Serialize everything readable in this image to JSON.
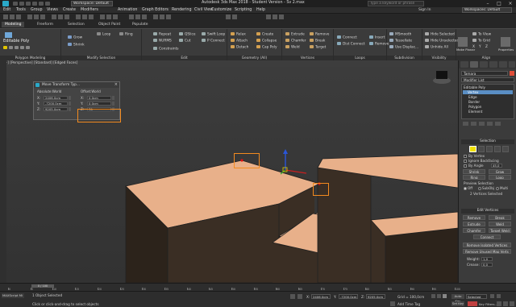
{
  "titlebar": {
    "workspace": "Workspace: Default",
    "title": "Autodesk 3ds Max 2018 - Student Version  - Sv 2.max",
    "search_placeholder": "Type a keyword or phrase"
  },
  "menubar": {
    "items": [
      "Edit",
      "Tools",
      "Group",
      "Views",
      "Create",
      "Modifiers",
      "Animation",
      "Graph Editors",
      "Rendering",
      "Civil View",
      "Customize",
      "Scripting",
      "Help"
    ],
    "sign_in": "Sign In",
    "workspaces": "Workspaces: Default"
  },
  "ribbon_tabs": [
    "Modeling",
    "Freeform",
    "Selection",
    "Object Paint",
    "Populate"
  ],
  "ribbon": {
    "polygon_modeling": {
      "object": "Editable Poly",
      "label": "Polygon Modeling"
    },
    "modify_selection": {
      "buttons": [
        "Grow",
        "Shrink",
        "Loop",
        "Ring"
      ],
      "label": "Modify Selection"
    },
    "edit": {
      "buttons": [
        "Repeat",
        "QSlice",
        "Swift Loop",
        "NURMS",
        "Cut",
        "P Connect",
        "Constraints"
      ],
      "label": "Edit"
    },
    "geometry": {
      "buttons": [
        "Relax",
        "Create",
        "Attach",
        "Collapse",
        "Detach",
        "Cap Poly"
      ],
      "label": "Geometry (All)"
    },
    "vertices": {
      "buttons": [
        "Extrude",
        "Remove",
        "Chamfer",
        "Break",
        "Weld",
        "Target"
      ],
      "label": "Vertices"
    },
    "loops": {
      "buttons": [
        "Connect",
        "Dist Connect",
        "Insert",
        "Remove"
      ],
      "label": "Loops"
    },
    "subdivision": {
      "buttons": [
        "MSmooth",
        "Tessellate",
        "Use Displac..."
      ],
      "label": "Subdivision"
    },
    "visibility": {
      "buttons": [
        "Hide Selected",
        "Hide Unselected",
        "Unhide All"
      ],
      "label": "Visibility"
    },
    "align": {
      "buttons": [
        "To View",
        "To Grid",
        "X",
        "Y",
        "Z"
      ],
      "make_planar": "Make Planar",
      "properties": "Properties",
      "label": "Align"
    }
  },
  "viewport": {
    "label": "[+] [Perspective] [Standard] [Edged Faces]"
  },
  "move_transform": {
    "title": "Move Transform Typ...",
    "absolute_label": "Absolute:World",
    "offset_label": "Offset:World",
    "absolute": {
      "x": "2406,0cm",
      "y": "-7200,0cm",
      "z": "9205,0cm"
    },
    "offset": {
      "x": "0,0cm",
      "y": "0,0cm",
      "z": "70"
    }
  },
  "command_panel": {
    "object_name": "Tamara",
    "modifier_list": "Modifier List",
    "stack": [
      "Editable Poly",
      "Vertex",
      "Edge",
      "Border",
      "Polygon",
      "Element"
    ],
    "selection_header": "Selection",
    "by_vertex": "By Vertex",
    "ignore_backfacing": "Ignore Backfacing",
    "by_angle": "By Angle",
    "angle_value": "45,0",
    "shrink": "Shrink",
    "grow": "Grow",
    "ring": "Ring",
    "loop": "Loop",
    "preview_selection": "Preview Selection",
    "preview_off": "Off",
    "preview_subobj": "SubObj",
    "preview_multi": "Multi",
    "vertices_selected": "2 Vertices Selected",
    "edit_vertices_header": "Edit Vertices",
    "remove": "Remove",
    "break": "Break",
    "extrude": "Extrude",
    "weld": "Weld",
    "chamfer": "Chamfer",
    "target_weld": "Target Weld",
    "connect": "Connect",
    "remove_isolated": "Remove Isolated Vertices",
    "remove_unused": "Remove Unused Map Verts",
    "weight_label": "Weight:",
    "weight_value": "1,0",
    "crease_label": "Crease:",
    "crease_value": "0,0"
  },
  "timeline": {
    "slider": "0 / 100",
    "ticks": [
      "0",
      "5",
      "10",
      "15",
      "20",
      "25",
      "30",
      "35",
      "40",
      "45",
      "50",
      "55",
      "60",
      "65",
      "70",
      "75",
      "80",
      "85",
      "90",
      "95",
      "100"
    ]
  },
  "status": {
    "maxscript": "MAXScript Mi",
    "selection": "1 Object Selected",
    "prompt": "Click or click-and-drag to select objects",
    "x_label": "X:",
    "x_value": "2406,0cm",
    "y_label": "Y:",
    "y_value": "-7200,0cm",
    "z_label": "Z:",
    "z_value": "9205,0cm",
    "grid": "Grid = 100,0cm",
    "add_time_tag": "Add Time Tag",
    "auto_key": "Auto Key",
    "selected": "Selected",
    "set_key": "Set Key",
    "key_filters": "Key Filters..."
  },
  "colors": {
    "object_face": "#e8b08a",
    "object_side": "#3a2e24",
    "highlight": "#f28a1f",
    "selected_vertex_icon": "#f0e000",
    "object_color": "#e04e39"
  }
}
